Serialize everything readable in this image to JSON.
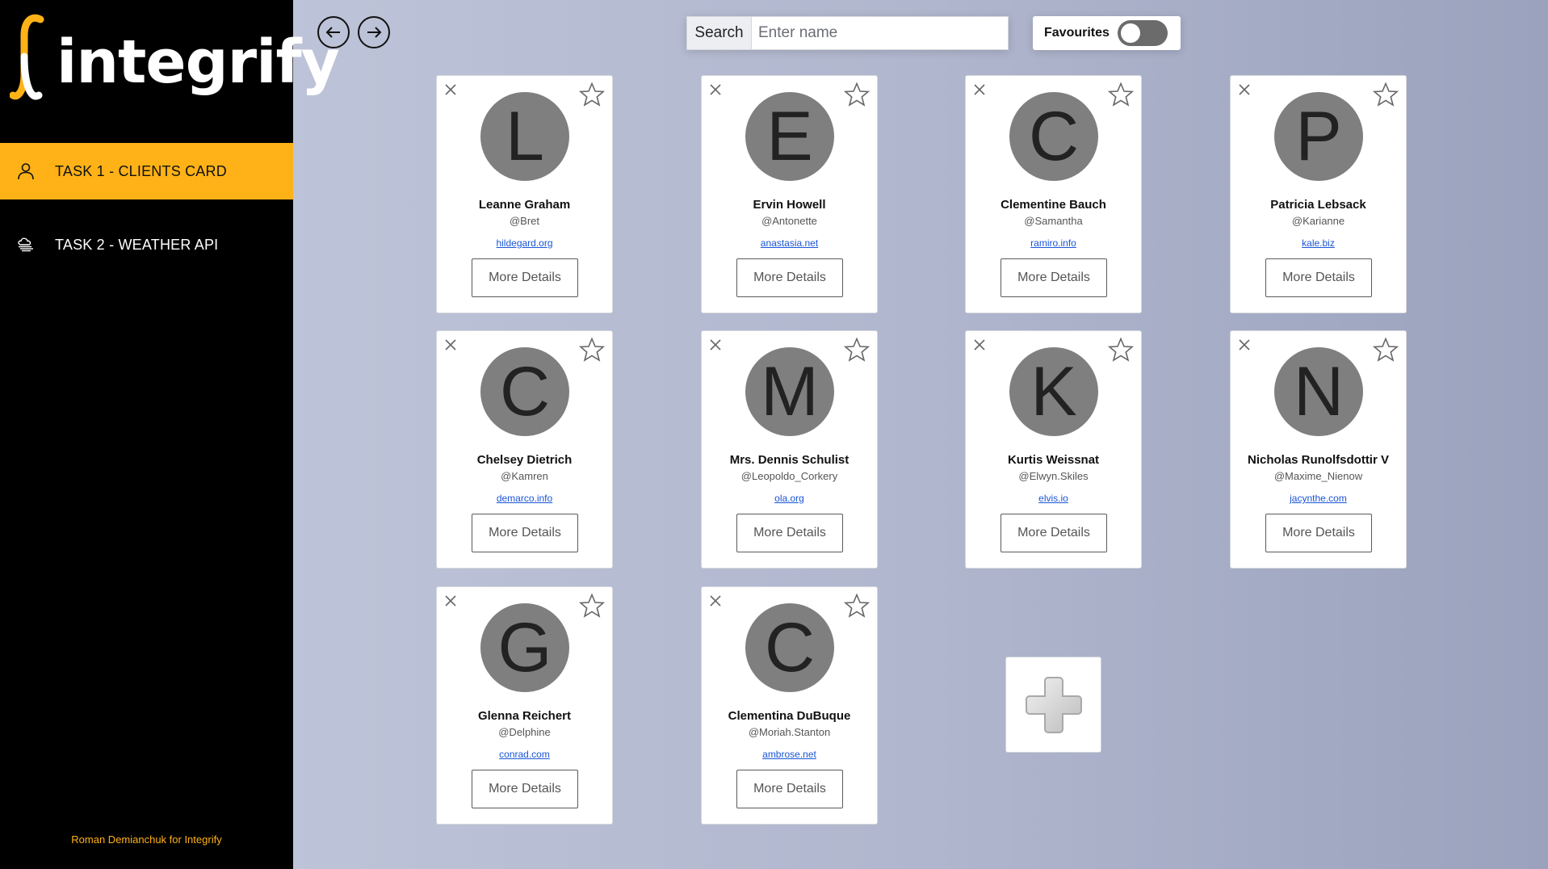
{
  "sidebar": {
    "logo_text": "integrify",
    "items": [
      {
        "label": "TASK 1 - CLIENTS CARD",
        "icon": "user-icon",
        "active": true
      },
      {
        "label": "TASK 2 - WEATHER API",
        "icon": "cloud-icon",
        "active": false
      }
    ],
    "footer": "Roman Demianchuk for Integrify"
  },
  "toolbar": {
    "back_icon": "arrow-left-icon",
    "forward_icon": "arrow-right-icon",
    "search_label": "Search",
    "search_placeholder": "Enter name",
    "search_value": "",
    "favourites_label": "Favourites",
    "favourites_on": false
  },
  "cards": [
    {
      "initial": "L",
      "name": "Leanne Graham",
      "username": "@Bret",
      "website": "hildegard.org",
      "button": "More Details"
    },
    {
      "initial": "E",
      "name": "Ervin Howell",
      "username": "@Antonette",
      "website": "anastasia.net",
      "button": "More Details"
    },
    {
      "initial": "C",
      "name": "Clementine Bauch",
      "username": "@Samantha",
      "website": "ramiro.info",
      "button": "More Details"
    },
    {
      "initial": "P",
      "name": "Patricia Lebsack",
      "username": "@Karianne",
      "website": "kale.biz",
      "button": "More Details"
    },
    {
      "initial": "C",
      "name": "Chelsey Dietrich",
      "username": "@Kamren",
      "website": "demarco.info",
      "button": "More Details"
    },
    {
      "initial": "M",
      "name": "Mrs. Dennis Schulist",
      "username": "@Leopoldo_Corkery",
      "website": "ola.org",
      "button": "More Details"
    },
    {
      "initial": "K",
      "name": "Kurtis Weissnat",
      "username": "@Elwyn.Skiles",
      "website": "elvis.io",
      "button": "More Details"
    },
    {
      "initial": "N",
      "name": "Nicholas Runolfsdottir V",
      "username": "@Maxime_Nienow",
      "website": "jacynthe.com",
      "button": "More Details"
    },
    {
      "initial": "G",
      "name": "Glenna Reichert",
      "username": "@Delphine",
      "website": "conrad.com",
      "button": "More Details"
    },
    {
      "initial": "C",
      "name": "Clementina DuBuque",
      "username": "@Moriah.Stanton",
      "website": "ambrose.net",
      "button": "More Details"
    }
  ],
  "add_card": {
    "icon": "plus-icon"
  },
  "colors": {
    "accent": "#ffb217",
    "sidebar_bg": "#000000",
    "avatar_bg": "#7f7f7f",
    "link": "#1a55d6"
  }
}
